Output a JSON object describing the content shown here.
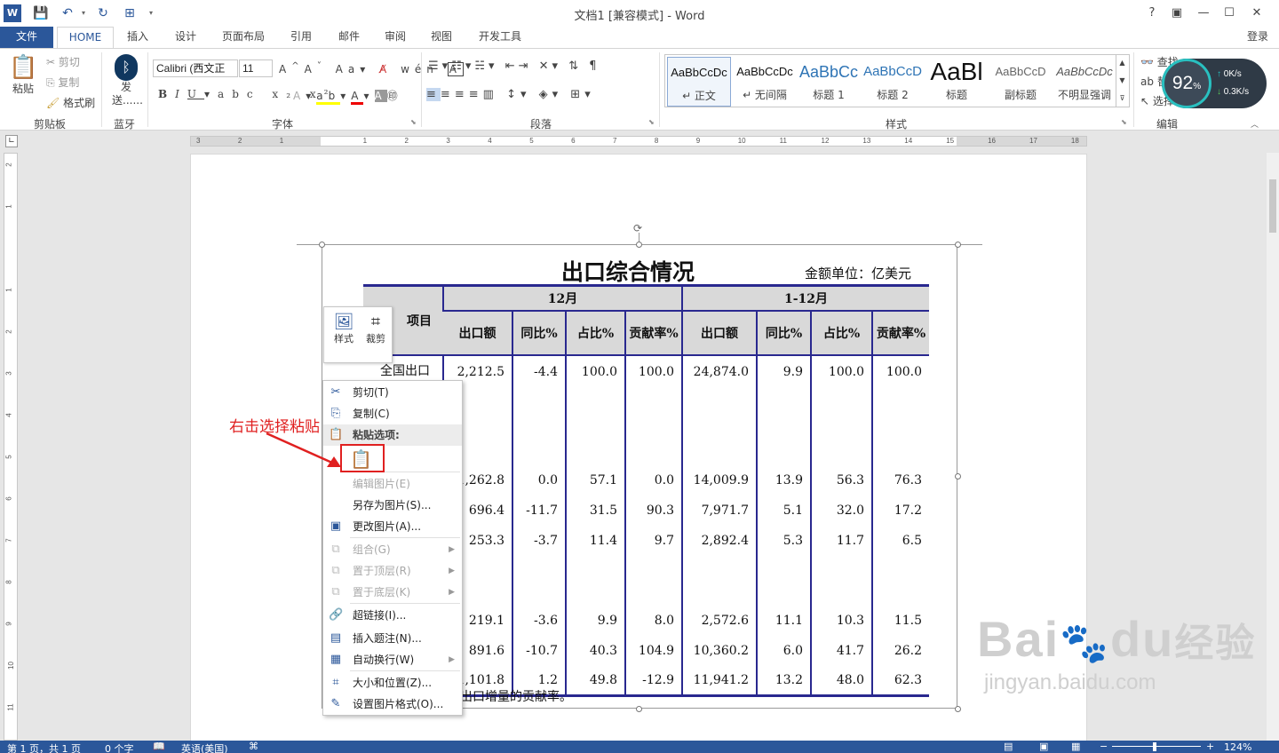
{
  "app": {
    "title": "文档1 [兼容模式] - Word",
    "login_label": "登录",
    "window_buttons": [
      "?",
      "▣",
      "—",
      "☐",
      "✕"
    ]
  },
  "tabs": [
    "文件",
    "HOME",
    "插入",
    "设计",
    "页面布局",
    "引用",
    "邮件",
    "审阅",
    "视图",
    "开发工具"
  ],
  "ribbon": {
    "clipboard": {
      "paste": "粘贴",
      "cut": "剪切",
      "copy": "复制",
      "format_painter": "格式刷",
      "group": "剪贴板"
    },
    "bluetooth": {
      "send": "发送......",
      "group": "蓝牙"
    },
    "font": {
      "name": "Calibri (西文正",
      "size": "11",
      "group": "字体"
    },
    "paragraph": {
      "group": "段落"
    },
    "styles": {
      "group": "样式",
      "items": [
        {
          "preview": "AaBbCcDc",
          "name": "↵ 正文"
        },
        {
          "preview": "AaBbCcDc",
          "name": "↵ 无间隔"
        },
        {
          "preview": "AaBbCc",
          "name": "标题 1"
        },
        {
          "preview": "AaBbCcD",
          "name": "标题 2"
        },
        {
          "preview": "AaBl",
          "name": "标题"
        },
        {
          "preview": "AaBbCcD",
          "name": "副标题"
        },
        {
          "preview": "AaBbCcDc",
          "name": "不明显强调"
        }
      ]
    },
    "editing": {
      "find": "查找",
      "replace": "替换",
      "select": "选择",
      "group": "编辑"
    }
  },
  "speed_widget": {
    "percent": "92",
    "unit": "%",
    "up": "0K/s",
    "down": "0.3K/s"
  },
  "ruler": {
    "h_ticks": [
      "3",
      "2",
      "1",
      "",
      "1",
      "2",
      "3",
      "4",
      "5",
      "6",
      "7",
      "8",
      "9",
      "10",
      "11",
      "12",
      "13",
      "14",
      "15",
      "16",
      "17",
      "18"
    ],
    "v_ticks": [
      "2",
      "1",
      "",
      "1",
      "2",
      "3",
      "4",
      "5",
      "6",
      "7",
      "8",
      "9",
      "10",
      "11"
    ]
  },
  "document": {
    "table_title": "出口综合情况",
    "unit": "金额单位：亿美元",
    "header_item": "项目",
    "header_groups": [
      "12月",
      "1-12月"
    ],
    "sub_headers": [
      "出口额",
      "同比%",
      "占比%",
      "贡献率%",
      "出口额",
      "同比%",
      "占比%",
      "贡献率%"
    ],
    "rows": [
      {
        "label": "全国出口",
        "values": [
          "2,212.5",
          "-4.4",
          "100.0",
          "100.0",
          "24,874.0",
          "9.9",
          "100.0",
          "100.0"
        ]
      },
      {
        "label": "",
        "values": [
          "",
          "",
          "",
          "",
          "",
          "",
          "",
          ""
        ]
      },
      {
        "label": "",
        "values": [
          "",
          "",
          "",
          "",
          "",
          "",
          "",
          ""
        ]
      },
      {
        "label": "",
        "values": [
          "1,262.8",
          "0.0",
          "57.1",
          "0.0",
          "14,009.9",
          "13.9",
          "56.3",
          "76.3"
        ]
      },
      {
        "label": "",
        "values": [
          "696.4",
          "-11.7",
          "31.5",
          "90.3",
          "7,971.7",
          "5.1",
          "32.0",
          "17.2"
        ]
      },
      {
        "label": "",
        "values": [
          "253.3",
          "-3.7",
          "11.4",
          "9.7",
          "2,892.4",
          "5.3",
          "11.7",
          "6.5"
        ]
      },
      {
        "label": "",
        "values": [
          "",
          "",
          "",
          "",
          "",
          "",
          "",
          ""
        ]
      },
      {
        "label": "",
        "values": [
          "219.1",
          "-3.6",
          "9.9",
          "8.0",
          "2,572.6",
          "11.1",
          "10.3",
          "11.5"
        ]
      },
      {
        "label": "",
        "values": [
          "891.6",
          "-10.7",
          "40.3",
          "104.9",
          "10,360.2",
          "6.0",
          "41.7",
          "26.2"
        ]
      },
      {
        "label": "",
        "values": [
          "1,101.8",
          "1.2",
          "49.8",
          "-12.9",
          "11,941.2",
          "13.2",
          "48.0",
          "62.3"
        ]
      }
    ],
    "footnote": "出口增量的贡献率。"
  },
  "mini_toolbar": {
    "style": "样式",
    "crop": "裁剪"
  },
  "context_menu": [
    {
      "label": "剪切(T)",
      "icon": "scissors-icon",
      "glyph": "✂",
      "enabled": true
    },
    {
      "label": "复制(C)",
      "icon": "copy-icon",
      "glyph": "⎘",
      "enabled": true
    },
    {
      "label": "粘贴选项:",
      "icon": "paste-icon",
      "glyph": "📋",
      "enabled": true,
      "header": true
    },
    {
      "label": "",
      "icon": "paste-option-icon",
      "glyph": "",
      "enabled": true,
      "paste": true
    },
    {
      "label": "编辑图片(E)",
      "icon": "",
      "glyph": "",
      "enabled": false
    },
    {
      "label": "另存为图片(S)...",
      "icon": "",
      "glyph": "",
      "enabled": true
    },
    {
      "label": "更改图片(A)...",
      "icon": "change-picture-icon",
      "glyph": "▣",
      "enabled": true
    },
    {
      "label": "组合(G)",
      "icon": "group-icon",
      "glyph": "⧉",
      "enabled": false,
      "submenu": true
    },
    {
      "label": "置于顶层(R)",
      "icon": "bring-front-icon",
      "glyph": "⧉",
      "enabled": false,
      "submenu": true
    },
    {
      "label": "置于底层(K)",
      "icon": "send-back-icon",
      "glyph": "⧉",
      "enabled": false,
      "submenu": true
    },
    {
      "label": "超链接(I)...",
      "icon": "hyperlink-icon",
      "glyph": "🔗",
      "enabled": true
    },
    {
      "label": "插入题注(N)...",
      "icon": "caption-icon",
      "glyph": "▤",
      "enabled": true
    },
    {
      "label": "自动换行(W)",
      "icon": "wrap-text-icon",
      "glyph": "▦",
      "enabled": true,
      "submenu": true
    },
    {
      "label": "大小和位置(Z)...",
      "icon": "size-position-icon",
      "glyph": "⌗",
      "enabled": true
    },
    {
      "label": "设置图片格式(O)...",
      "icon": "format-picture-icon",
      "glyph": "✎",
      "enabled": true
    }
  ],
  "annotation": {
    "text": "右击选择粘贴",
    "color": "#e02020"
  },
  "watermark": {
    "brand": "Bai",
    "brand2": "du",
    "cn": "经验",
    "url": "jingyan.baidu.com"
  },
  "statusbar": {
    "page": "第 1 页，共 1 页",
    "words": "0 个字",
    "lang": "英语(美国)",
    "zoom": "124%"
  },
  "colors": {
    "accent": "#2b579a",
    "table_border": "#29288f",
    "annotation": "#e02020"
  }
}
